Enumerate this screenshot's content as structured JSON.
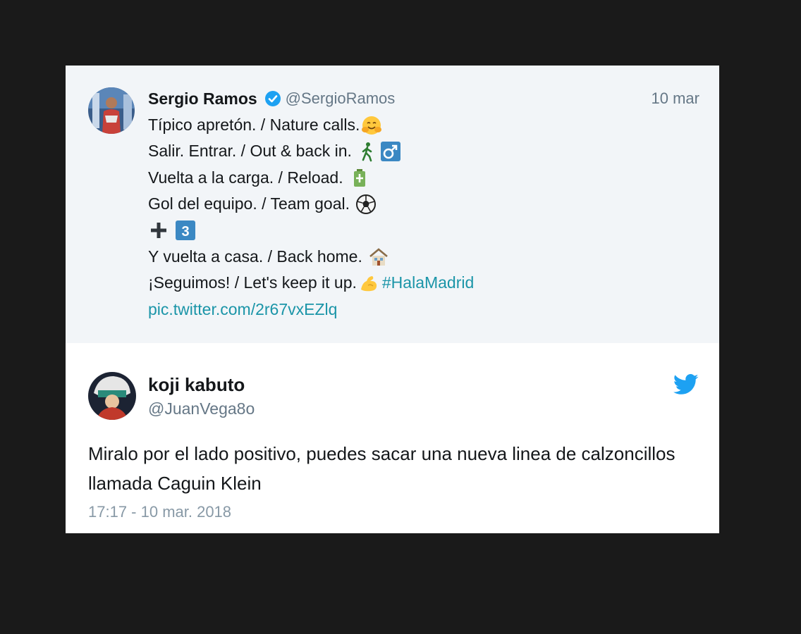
{
  "quoted_tweet": {
    "author_name": "Sergio Ramos",
    "author_handle": "@SergioRamos",
    "date": "10 mar",
    "lines": {
      "l1": "Típico apretón. / Nature calls.",
      "l2": "Salir. Entrar. / Out & back in.",
      "l3": "Vuelta a la carga. / Reload.",
      "l4": "Gol del equipo. / Team goal.",
      "l6": "Y vuelta a casa. / Back home.",
      "l7": "¡Seguimos! / Let's keep it up.",
      "hashtag": "#HalaMadrid",
      "link": "pic.twitter.com/2r67vxEZlq"
    },
    "emojis": [
      "hugging-face",
      "walking-man",
      "male-sign",
      "battery",
      "soccer-ball",
      "plus",
      "keycap-3",
      "house",
      "flexed-biceps"
    ]
  },
  "reply_tweet": {
    "author_name": "koji kabuto",
    "author_handle": "@JuanVega8o",
    "text": "Miralo por el lado positivo, puedes sacar una nueva linea de calzoncillos llamada Caguin Klein",
    "timestamp": "17:17 - 10 mar. 2018"
  },
  "colors": {
    "background": "#1a1a1a",
    "quoted_bg": "#f2f5f8",
    "link": "#1b95a8",
    "twitter_blue": "#1da1f2",
    "secondary_text": "#657786"
  }
}
